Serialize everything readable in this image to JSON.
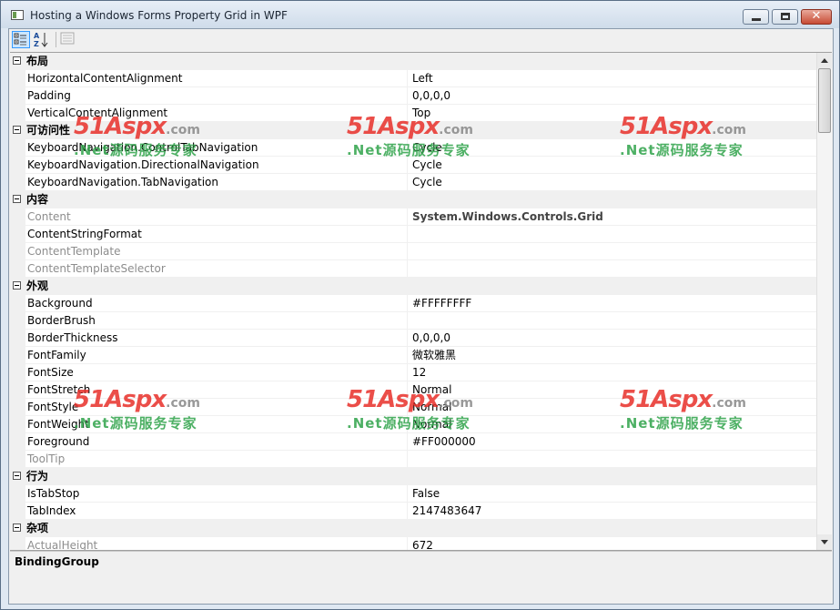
{
  "window": {
    "title": "Hosting a Windows Forms Property Grid in WPF",
    "close_glyph": "✕"
  },
  "toolbar": {
    "categorized_icon": "categorized-icon",
    "alphabetical_icon": "alphabetical-icon",
    "property_pages_icon": "property-pages-icon"
  },
  "grid": {
    "rows": [
      {
        "kind": "category",
        "label": "布局"
      },
      {
        "kind": "prop",
        "name": "HorizontalContentAlignment",
        "value": "Left"
      },
      {
        "kind": "prop",
        "name": "Padding",
        "value": "0,0,0,0"
      },
      {
        "kind": "prop",
        "name": "VerticalContentAlignment",
        "value": "Top"
      },
      {
        "kind": "category",
        "label": "可访问性"
      },
      {
        "kind": "prop",
        "name": "KeyboardNavigation.ControlTabNavigation",
        "value": "Cycle"
      },
      {
        "kind": "prop",
        "name": "KeyboardNavigation.DirectionalNavigation",
        "value": "Cycle"
      },
      {
        "kind": "prop",
        "name": "KeyboardNavigation.TabNavigation",
        "value": "Cycle"
      },
      {
        "kind": "category",
        "label": "内容"
      },
      {
        "kind": "prop",
        "name": "Content",
        "value": "System.Windows.Controls.Grid",
        "readonly": true,
        "value_bold": true
      },
      {
        "kind": "prop",
        "name": "ContentStringFormat",
        "value": ""
      },
      {
        "kind": "prop",
        "name": "ContentTemplate",
        "value": "",
        "readonly": true
      },
      {
        "kind": "prop",
        "name": "ContentTemplateSelector",
        "value": "",
        "readonly": true
      },
      {
        "kind": "category",
        "label": "外观"
      },
      {
        "kind": "prop",
        "name": "Background",
        "value": "#FFFFFFFF"
      },
      {
        "kind": "prop",
        "name": "BorderBrush",
        "value": ""
      },
      {
        "kind": "prop",
        "name": "BorderThickness",
        "value": "0,0,0,0"
      },
      {
        "kind": "prop",
        "name": "FontFamily",
        "value": "微软雅黑"
      },
      {
        "kind": "prop",
        "name": "FontSize",
        "value": "12"
      },
      {
        "kind": "prop",
        "name": "FontStretch",
        "value": "Normal"
      },
      {
        "kind": "prop",
        "name": "FontStyle",
        "value": "Normal"
      },
      {
        "kind": "prop",
        "name": "FontWeight",
        "value": "Normal"
      },
      {
        "kind": "prop",
        "name": "Foreground",
        "value": "#FF000000"
      },
      {
        "kind": "prop",
        "name": "ToolTip",
        "value": "",
        "readonly": true
      },
      {
        "kind": "category",
        "label": "行为"
      },
      {
        "kind": "prop",
        "name": "IsTabStop",
        "value": "False"
      },
      {
        "kind": "prop",
        "name": "TabIndex",
        "value": "2147483647"
      },
      {
        "kind": "category",
        "label": "杂项"
      },
      {
        "kind": "prop",
        "name": "ActualHeight",
        "value": "672",
        "readonly": true
      }
    ]
  },
  "help": {
    "title": "BindingGroup"
  },
  "watermark": {
    "logo": "51Aspx",
    "domain": ".com",
    "tagline": ".Net源码服务专家"
  },
  "colors": {
    "title_bar": "#cfdcea",
    "close_button": "#c74b34",
    "category_bg": "#f0f0f0",
    "readonly_text": "#8d8d8d",
    "watermark_red": "#e8302a",
    "watermark_green": "#2fa34a"
  }
}
